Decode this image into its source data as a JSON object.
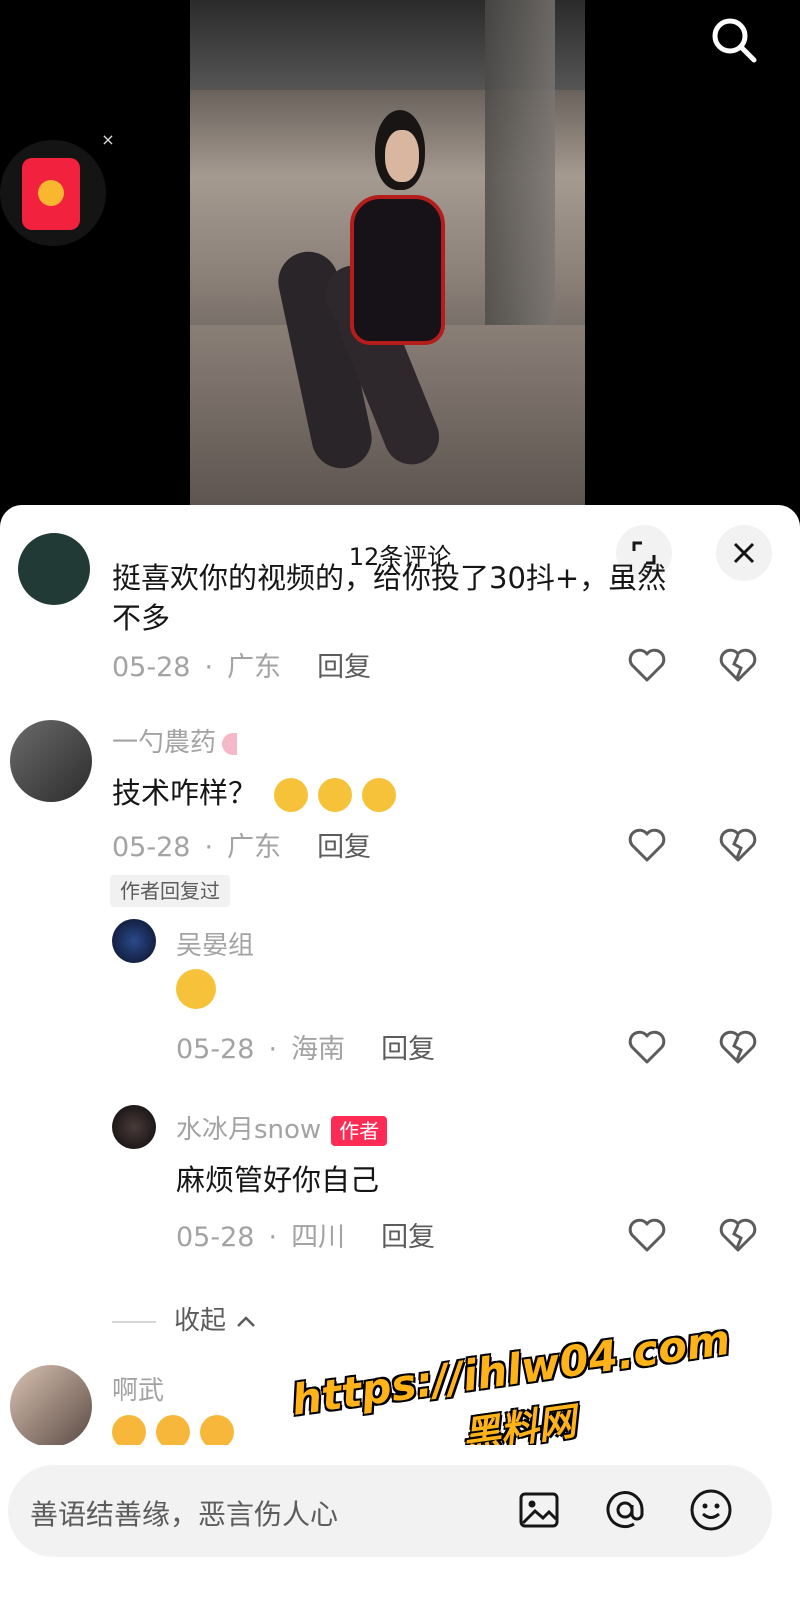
{
  "video": {
    "search_icon": "search-icon",
    "red_packet_icon": "red-envelope-icon",
    "close_glyph": "×"
  },
  "sheet": {
    "title": "12条评论",
    "expand_icon": "expand-icon",
    "close_icon": "close-icon"
  },
  "comments": {
    "partial": {
      "text_line1": "挺喜欢你的视频的，给你投了30抖+，虽然",
      "text_line2": "不多",
      "date": "05-28",
      "region": "广东",
      "reply": "回复"
    },
    "c1": {
      "username": "一勺農药",
      "text": "技术咋样？",
      "date": "05-28",
      "region": "广东",
      "reply": "回复",
      "replied_badge": "作者回复过"
    },
    "r1": {
      "username": "吴晏组",
      "date": "05-28",
      "region": "海南",
      "reply": "回复"
    },
    "r2": {
      "username": "水冰月snow",
      "author_tag": "作者",
      "text": "麻烦管好你自己",
      "date": "05-28",
      "region": "四川",
      "reply": "回复"
    },
    "collapse": "收起",
    "c2": {
      "username": "啊武"
    }
  },
  "watermark": {
    "url": "https://ihlw04.com",
    "name": "黑料网"
  },
  "input": {
    "placeholder": "善语结善缘，恶言伤人心",
    "image_icon": "image-icon",
    "mention_icon": "at-icon",
    "emoji_icon": "emoji-icon"
  },
  "colors": {
    "accent": "#fe2c55",
    "text": "#161616",
    "muted": "#a3a3a3",
    "watermark": "#ffb318"
  }
}
